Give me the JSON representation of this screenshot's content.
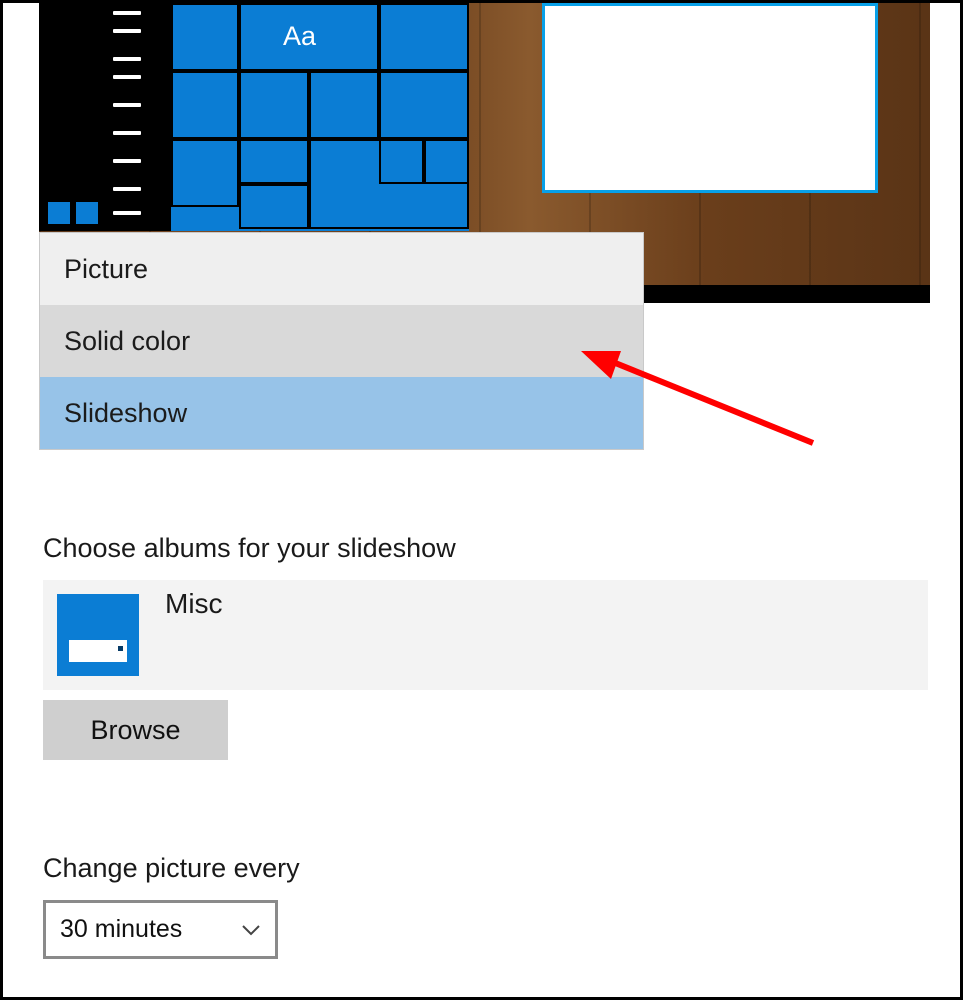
{
  "preview": {
    "sample_text": "Aa"
  },
  "background_dropdown": {
    "options": {
      "picture": "Picture",
      "solid_color": "Solid color",
      "slideshow": "Slideshow"
    }
  },
  "albums": {
    "title": "Choose albums for your slideshow",
    "selected": "Misc",
    "browse_label": "Browse"
  },
  "interval": {
    "title": "Change picture every",
    "value": "30 minutes"
  }
}
